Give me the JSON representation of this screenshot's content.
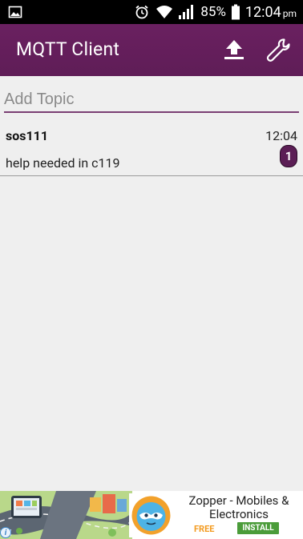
{
  "status_bar": {
    "battery_percent": "85%",
    "time": "12:04",
    "ampm": "pm",
    "icons": [
      "image-icon",
      "alarm-icon",
      "wifi-icon",
      "signal-icon",
      "battery-icon"
    ]
  },
  "app_bar": {
    "title": "MQTT Client",
    "actions": [
      "upload-icon",
      "wrench-icon"
    ],
    "color": "#651f5c"
  },
  "topic_input": {
    "placeholder": "Add Topic",
    "value": ""
  },
  "messages": [
    {
      "topic": "sos111",
      "time": "12:04",
      "body": "help needed in c119",
      "unread_count": "1"
    }
  ],
  "ad": {
    "title": "Zopper - Mobiles & Electronics",
    "price": "FREE",
    "cta": "INSTALL",
    "info_symbol": "i"
  }
}
